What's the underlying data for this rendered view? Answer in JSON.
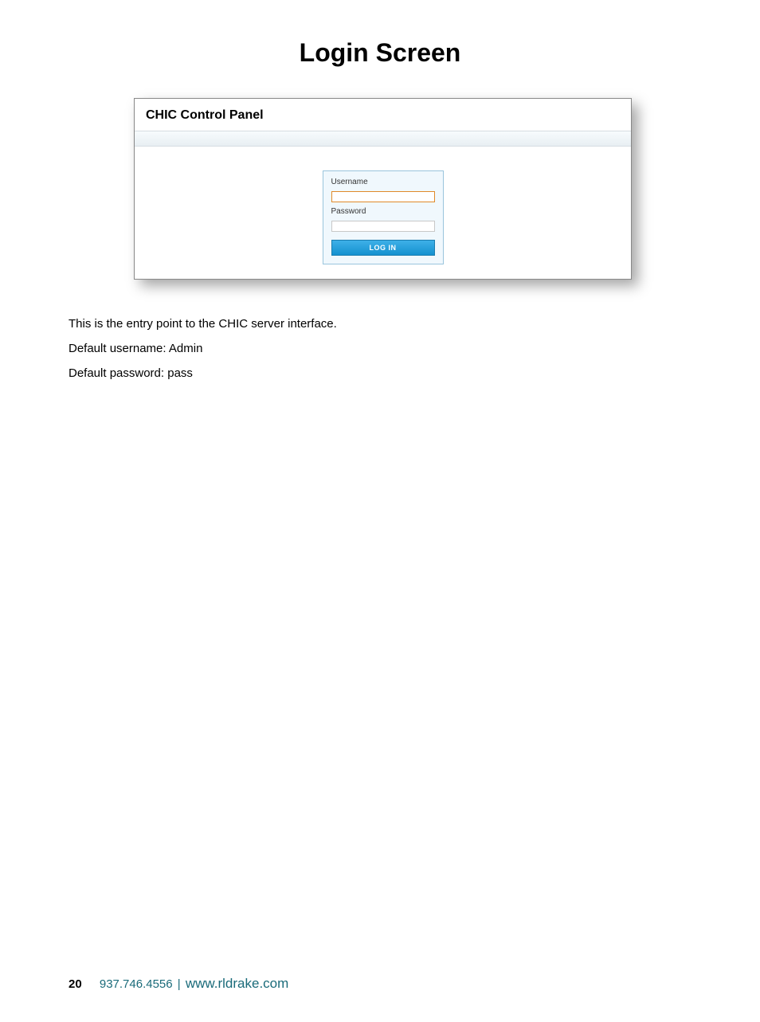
{
  "page": {
    "title": "Login Screen"
  },
  "screenshot": {
    "panel_title": "CHIC Control Panel",
    "login": {
      "username_label": "Username",
      "username_value": "",
      "password_label": "Password",
      "password_value": "",
      "button_label": "LOG IN"
    }
  },
  "body": {
    "line1": "This is the entry point to the CHIC server interface.",
    "line2": "Default username: Admin",
    "line3": "Default password: pass"
  },
  "footer": {
    "page_number": "20",
    "phone": "937.746.4556",
    "separator": "|",
    "url": "www.rldrake.com"
  }
}
